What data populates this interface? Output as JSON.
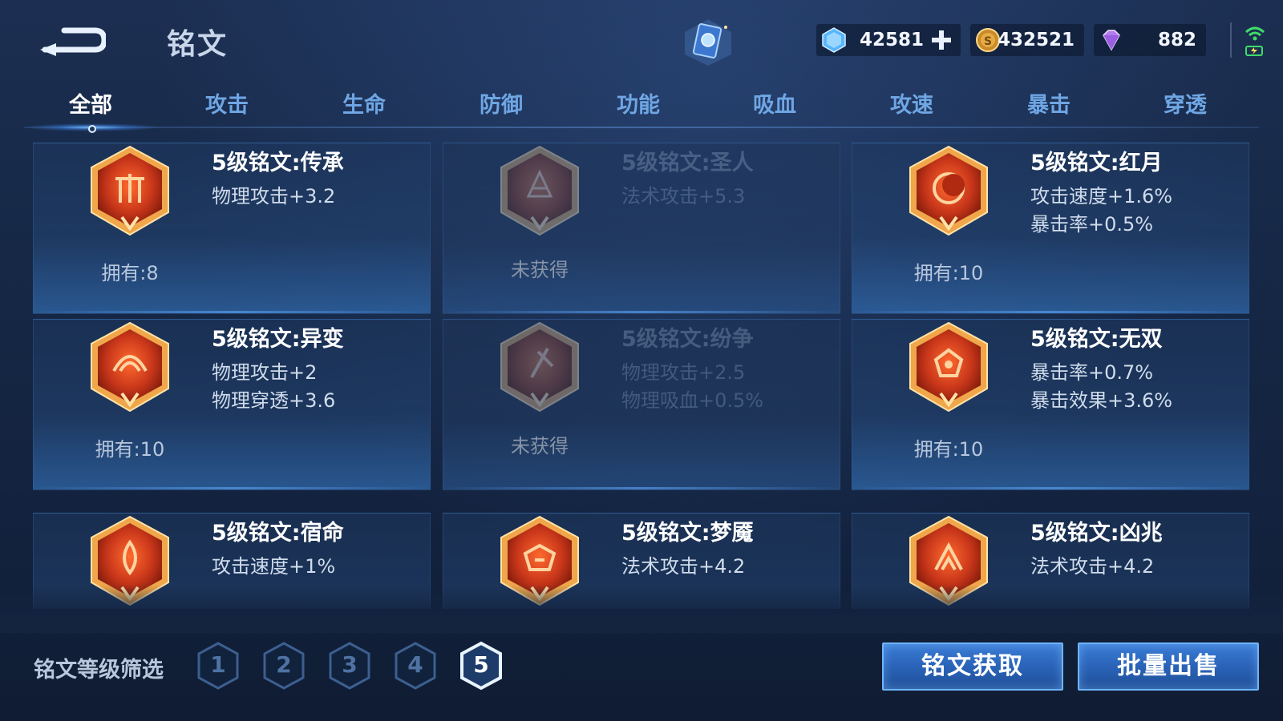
{
  "header": {
    "title": "铭文",
    "currencies": {
      "gem": "42581",
      "gold": "432521",
      "diamond": "882"
    }
  },
  "tabs": [
    "全部",
    "攻击",
    "生命",
    "防御",
    "功能",
    "吸血",
    "攻速",
    "暴击",
    "穿透"
  ],
  "active_tab": "全部",
  "inscriptions": [
    {
      "name": "5级铭文:传承",
      "attrs": [
        "物理攻击+3.2",
        ""
      ],
      "owned": "拥有:8",
      "locked": false
    },
    {
      "name": "5级铭文:圣人",
      "attrs": [
        "法术攻击+5.3",
        ""
      ],
      "owned": "未获得",
      "locked": true
    },
    {
      "name": "5级铭文:红月",
      "attrs": [
        "攻击速度+1.6%",
        "暴击率+0.5%"
      ],
      "owned": "拥有:10",
      "locked": false
    },
    {
      "name": "5级铭文:异变",
      "attrs": [
        "物理攻击+2",
        "物理穿透+3.6"
      ],
      "owned": "拥有:10",
      "locked": false
    },
    {
      "name": "5级铭文:纷争",
      "attrs": [
        "物理攻击+2.5",
        "物理吸血+0.5%"
      ],
      "owned": "未获得",
      "locked": true
    },
    {
      "name": "5级铭文:无双",
      "attrs": [
        "暴击率+0.7%",
        "暴击效果+3.6%"
      ],
      "owned": "拥有:10",
      "locked": false
    },
    {
      "name": "5级铭文:宿命",
      "attrs": [
        "攻击速度+1%",
        ""
      ],
      "owned": "",
      "locked": false
    },
    {
      "name": "5级铭文:梦魇",
      "attrs": [
        "法术攻击+4.2",
        ""
      ],
      "owned": "",
      "locked": false
    },
    {
      "name": "5级铭文:凶兆",
      "attrs": [
        "法术攻击+4.2",
        ""
      ],
      "owned": "",
      "locked": false
    }
  ],
  "footer": {
    "filter_label": "铭文等级筛选",
    "levels": [
      "1",
      "2",
      "3",
      "4",
      "5"
    ],
    "active_level": "5",
    "get_button": "铭文获取",
    "sell_button": "批量出售"
  },
  "colors": {
    "accent": "#6fa6e4",
    "emblem_red": "#c8361a",
    "emblem_gold": "#f0a64a",
    "button_blue": "#2a63b8"
  }
}
